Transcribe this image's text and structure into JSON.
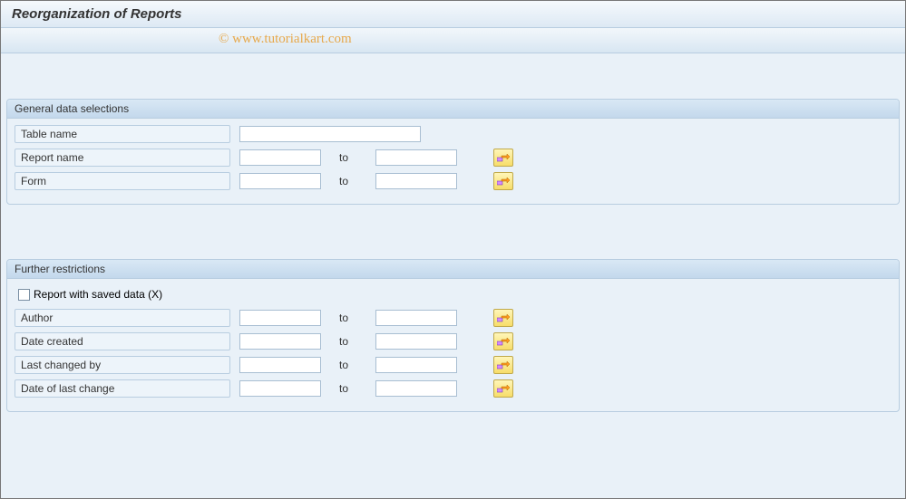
{
  "title": "Reorganization of Reports",
  "watermark": "© www.tutorialkart.com",
  "group1": {
    "header": "General data selections",
    "table_name_label": "Table name",
    "table_name_value": "",
    "report_name_label": "Report name",
    "report_name_from": "",
    "report_name_to": "",
    "form_label": "Form",
    "form_from": "",
    "form_to": "",
    "to_label": "to"
  },
  "group2": {
    "header": "Further restrictions",
    "checkbox_label": "Report with saved data (X)",
    "checkbox_checked": false,
    "author_label": "Author",
    "author_from": "",
    "author_to": "",
    "date_created_label": "Date created",
    "date_created_from": "",
    "date_created_to": "",
    "last_changed_by_label": "Last changed by",
    "last_changed_by_from": "",
    "last_changed_by_to": "",
    "date_last_change_label": "Date of last change",
    "date_last_change_from": "",
    "date_last_change_to": "",
    "to_label": "to"
  }
}
